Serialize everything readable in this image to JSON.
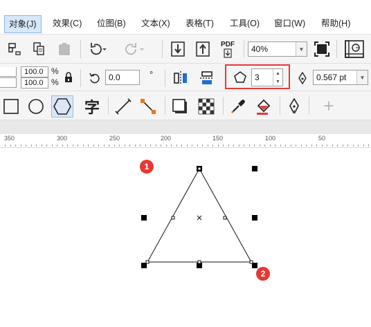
{
  "menu": {
    "items": [
      {
        "label": "对象(J)"
      },
      {
        "label": "效果(C)"
      },
      {
        "label": "位图(B)"
      },
      {
        "label": "文本(X)"
      },
      {
        "label": "表格(T)"
      },
      {
        "label": "工具(O)"
      },
      {
        "label": "窗口(W)"
      },
      {
        "label": "帮助(H)"
      }
    ],
    "active_index": 0
  },
  "toolbar1": {
    "pdf_label": "PDF",
    "zoom_value": "40%"
  },
  "toolbar2": {
    "scale_x": "100.0",
    "scale_y": "100.0",
    "percent_symbol": "%",
    "rotation": "0.0",
    "degree_symbol": "°",
    "polygon_points": "3",
    "outline_width": "0.567 pt"
  },
  "toolbar3": {
    "text_tool_glyph": "字",
    "add_glyph": "+"
  },
  "ruler": {
    "labels": [
      "350",
      "300",
      "250",
      "200",
      "150",
      "100",
      "50"
    ]
  },
  "badges": {
    "first": "1",
    "second": "2"
  },
  "colors": {
    "highlight": "#e53935",
    "menu_active_bg": "#d6e8fa",
    "accent_orange": "#e87722",
    "accent_blue": "#1e6fd0"
  },
  "icons": {
    "polygon": "pentagon-icon",
    "outline_pen": "pen-nib-icon",
    "rotate": "rotate-icon",
    "lock": "lock-icon"
  }
}
